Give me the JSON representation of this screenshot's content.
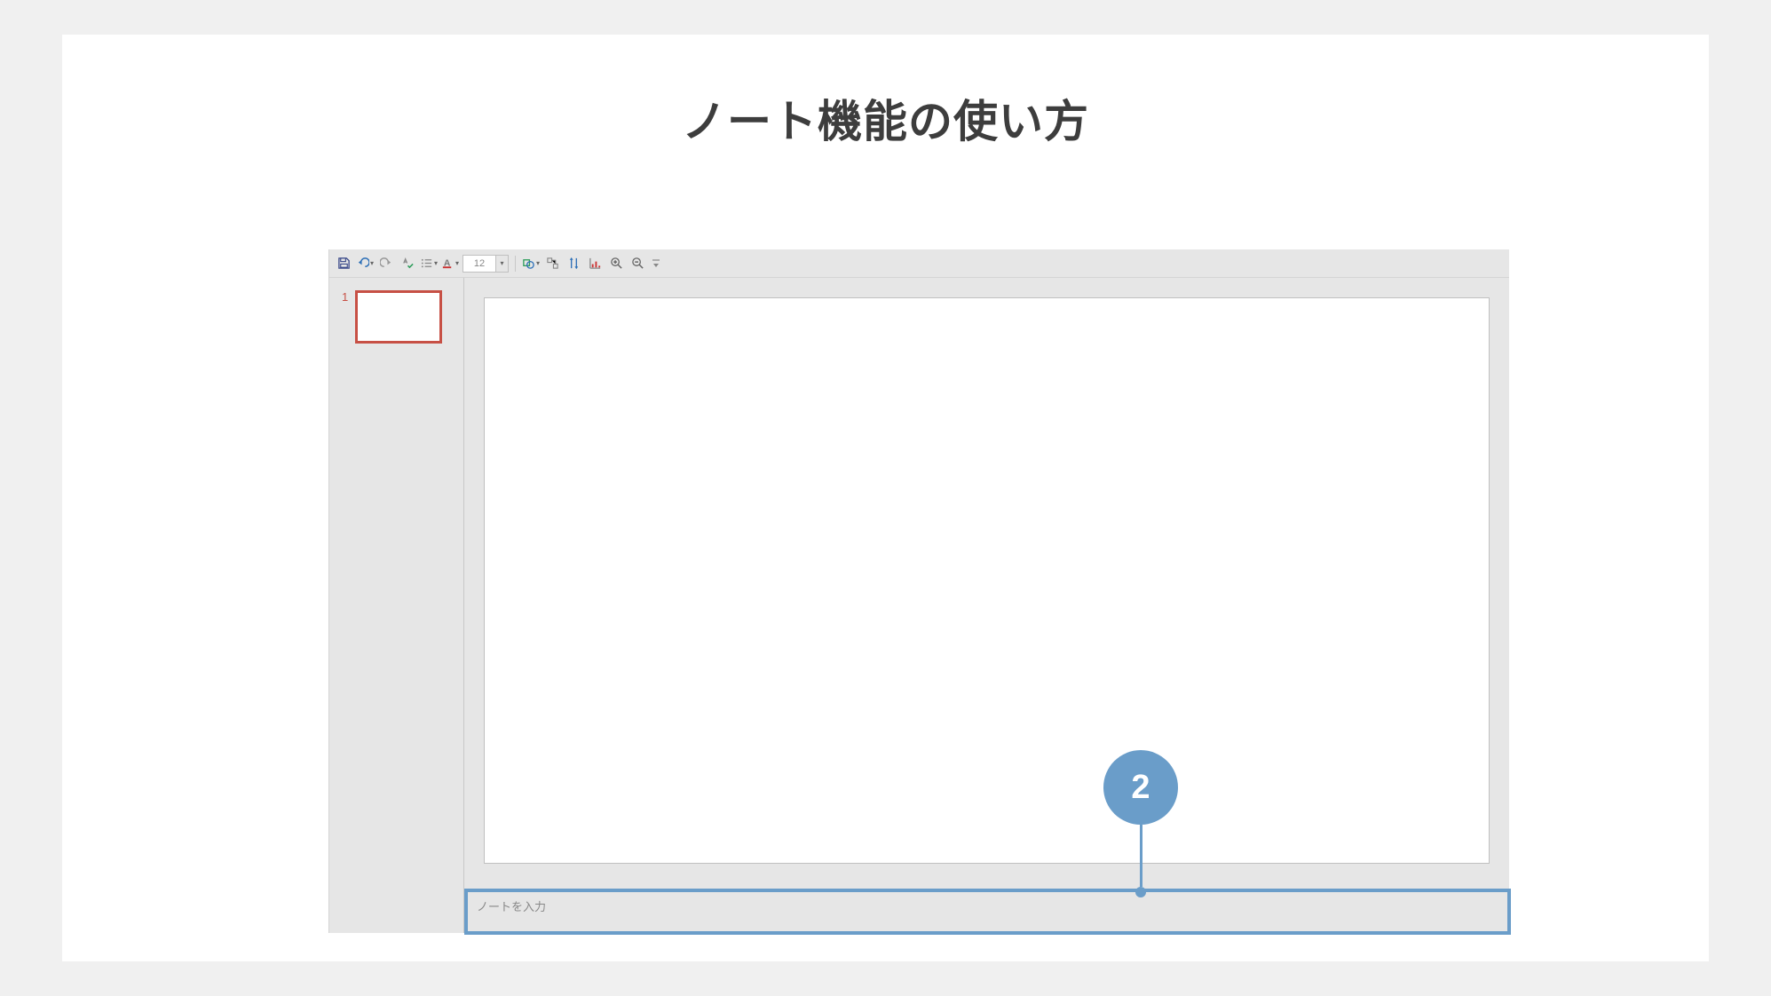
{
  "page_title": "ノート機能の使い方",
  "toolbar": {
    "font_size": "12"
  },
  "thumbnail": {
    "number": "1"
  },
  "notes": {
    "placeholder": "ノートを入力"
  },
  "callout": {
    "number": "2"
  }
}
